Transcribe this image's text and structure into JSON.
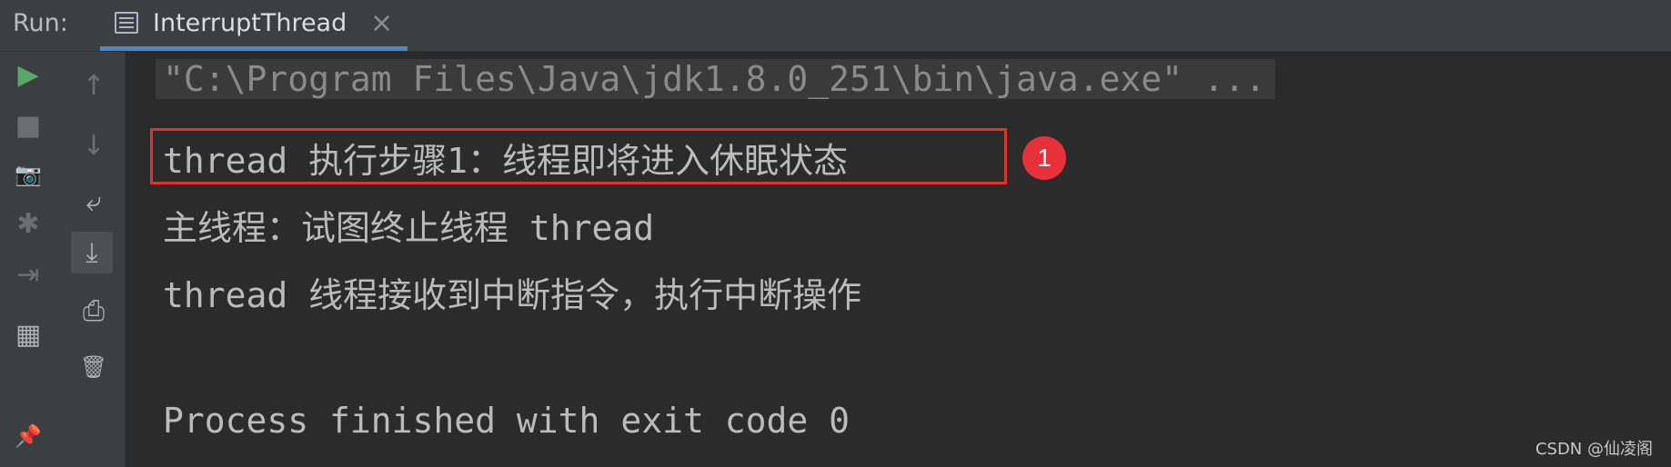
{
  "tabbar": {
    "run_label": "Run:",
    "tab_title": "InterruptThread",
    "tab_icon": "console-window-icon",
    "close_glyph": "×"
  },
  "left_toolbar": {
    "col1": [
      {
        "name": "run-icon",
        "glyph": "▶"
      },
      {
        "name": "stop-icon",
        "glyph": "■"
      },
      {
        "name": "camera-icon",
        "glyph": "📷"
      },
      {
        "name": "debug-bug-icon",
        "glyph": "✱"
      },
      {
        "name": "exit-icon",
        "glyph": "⇥"
      },
      {
        "name": "layout-icon",
        "glyph": "▦"
      },
      {
        "name": "pin-icon",
        "glyph": "📌"
      }
    ],
    "col2": [
      {
        "name": "up-arrow-icon",
        "glyph": "↑"
      },
      {
        "name": "down-arrow-icon",
        "glyph": "↓"
      },
      {
        "name": "soft-wrap-icon",
        "glyph": "⤶"
      },
      {
        "name": "scroll-to-end-icon",
        "glyph": "⤓"
      },
      {
        "name": "print-icon",
        "glyph": "⎙"
      },
      {
        "name": "trash-icon",
        "glyph": "🗑"
      }
    ]
  },
  "console": {
    "lines": [
      "\"C:\\Program Files\\Java\\jdk1.8.0_251\\bin\\java.exe\" ...",
      "thread 执行步骤1：线程即将进入休眠状态",
      "主线程：试图终止线程 thread",
      "thread 线程接收到中断指令，执行中断操作",
      "",
      "Process finished with exit code 0"
    ]
  },
  "annotation": {
    "badge_number": "1"
  },
  "watermark": "CSDN @仙凌阁",
  "colors": {
    "background": "#2b2b2b",
    "toolbar": "#3c3f41",
    "highlight": "#e03131",
    "accent": "#4a88c7",
    "run_green": "#59a869"
  }
}
